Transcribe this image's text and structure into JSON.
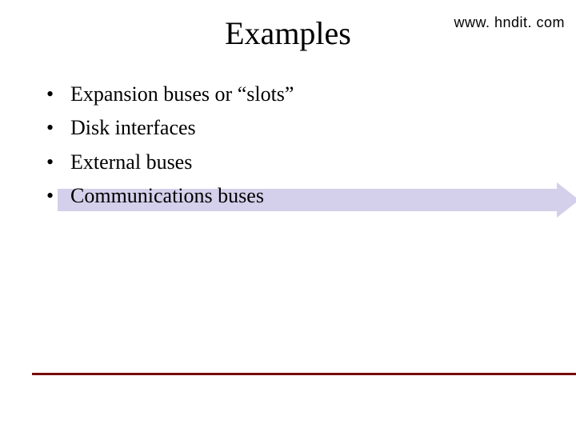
{
  "url_text": "www. hndit. com",
  "title": "Examples",
  "bullets": [
    "Expansion buses or “slots”",
    "Disk interfaces",
    "External buses",
    "Communications buses"
  ],
  "colors": {
    "arrow": "#d4cfea",
    "divider": "#7a0b0b"
  }
}
